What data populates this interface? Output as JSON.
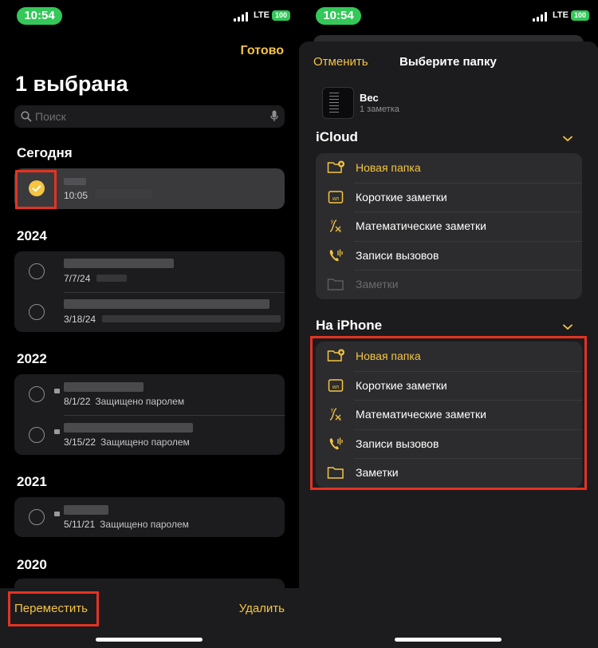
{
  "status": {
    "time": "10:54",
    "network": "LTE",
    "battery": "100"
  },
  "left": {
    "done_label": "Готово",
    "title": "1 выбрана",
    "search_placeholder": "Поиск",
    "sections": {
      "today": "Сегодня",
      "y2024": "2024",
      "y2022": "2022",
      "y2021": "2021",
      "y2020": "2020"
    },
    "notes": {
      "today_date": "10:05",
      "n2024a_date": "7/7/24",
      "n2024b_date": "3/18/24",
      "n2022a_date": "8/1/22",
      "n2022b_date": "3/15/22",
      "n2021a_date": "5/11/21",
      "locked_label": "Защищено паролем"
    },
    "move_label": "Переместить",
    "delete_label": "Удалить"
  },
  "right": {
    "cancel_label": "Отменить",
    "title": "Выберите папку",
    "note_title": "Вес",
    "note_count": "1 заметка",
    "icloud_header": "iCloud",
    "iphone_header": "На iPhone",
    "folders": {
      "new_folder": "Новая папка",
      "quick_notes": "Короткие заметки",
      "math_notes": "Математические заметки",
      "call_records": "Записи вызовов",
      "notes": "Заметки"
    }
  },
  "colors": {
    "accent": "#f5c542",
    "highlight": "#e53222",
    "status_green": "#34c759"
  }
}
